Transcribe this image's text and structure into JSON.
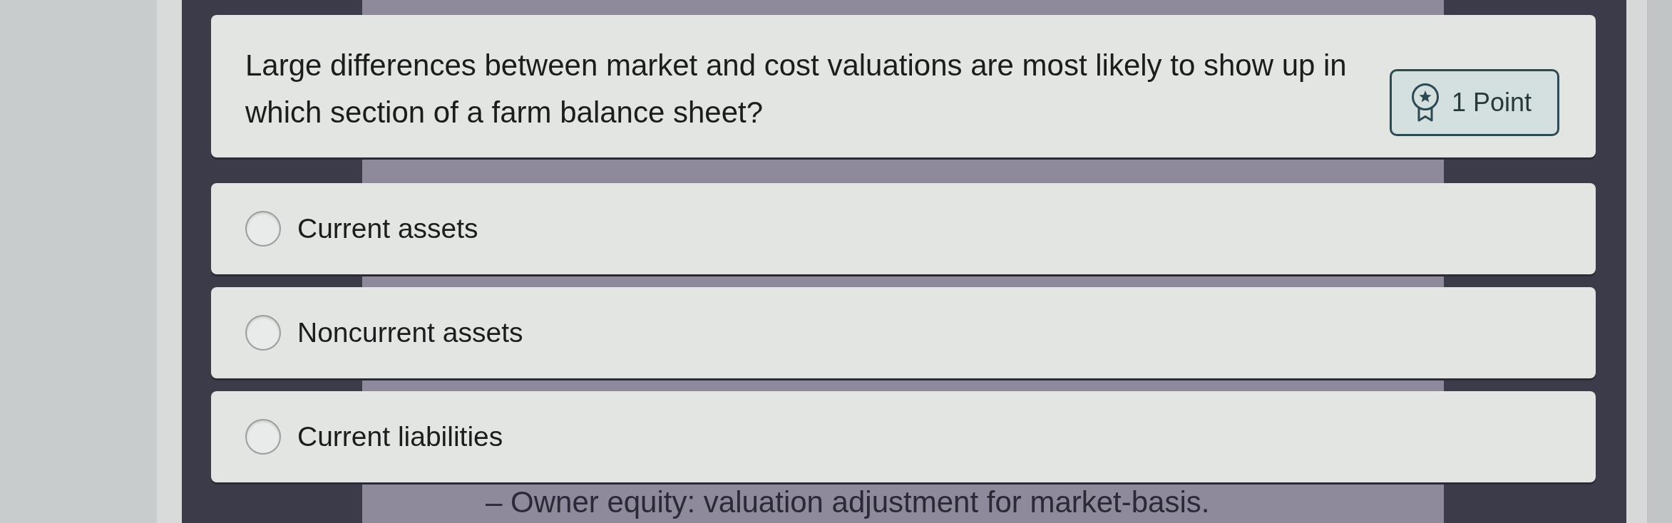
{
  "question": {
    "text": "Large differences between market and cost valuations are most likely to show up in which section of a farm balance sheet?",
    "points": "1 Point"
  },
  "options": [
    {
      "label": "Current assets",
      "selected": false
    },
    {
      "label": "Noncurrent assets",
      "selected": false
    },
    {
      "label": "Current liabilities",
      "selected": false
    }
  ],
  "note": "– Owner equity: valuation adjustment for market-basis."
}
